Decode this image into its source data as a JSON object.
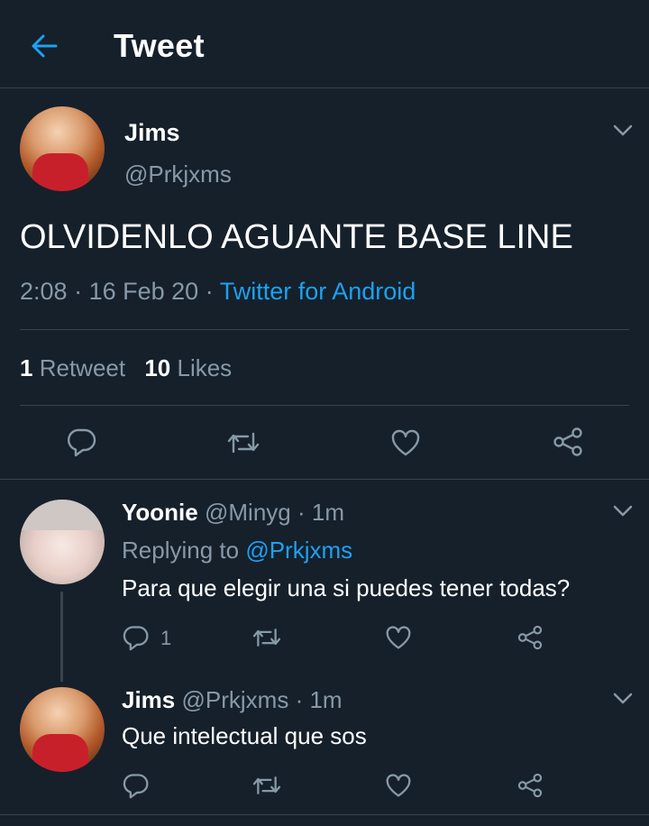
{
  "header": {
    "title": "Tweet"
  },
  "main_tweet": {
    "name": "Jims",
    "handle": "@Prkjxms",
    "text": "OLVIDENLO AGUANTE BASE LINE",
    "time": "2:08",
    "sep1": "·",
    "date": "16 Feb 20",
    "sep2": "·",
    "source": "Twitter for Android",
    "retweets_count": "1",
    "retweets_label": "Retweet",
    "likes_count": "10",
    "likes_label": "Likes"
  },
  "replies": [
    {
      "name": "Yoonie",
      "handle": "@Minyg",
      "sep": "·",
      "time": "1m",
      "replying_to_label": "Replying to",
      "replying_to_handle": "@Prkjxms",
      "text": "Para que elegir una si puedes tener todas?",
      "reply_count": "1"
    },
    {
      "name": "Jims",
      "handle": "@Prkjxms",
      "sep": "·",
      "time": "1m",
      "text": "Que intelectual que sos",
      "reply_count": ""
    }
  ],
  "colors": {
    "background": "#15202b",
    "accent": "#1da1f2",
    "muted": "#8899a6",
    "divider": "#38444d"
  },
  "icons": [
    "back-arrow-icon",
    "chevron-down-icon",
    "reply-icon",
    "retweet-icon",
    "like-icon",
    "share-icon"
  ]
}
